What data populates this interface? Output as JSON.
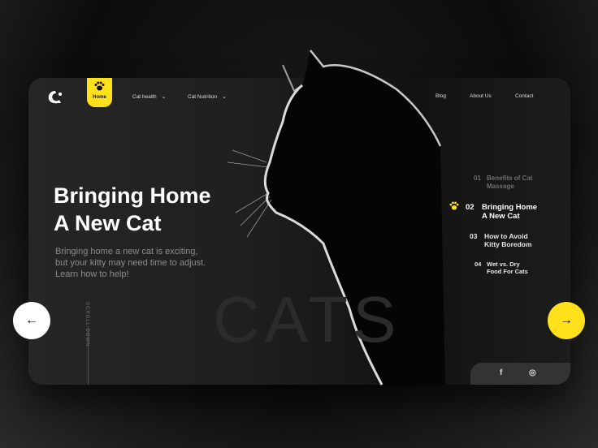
{
  "nav": {
    "home": "Home",
    "cat_health": "Cat health",
    "cat_nutrition": "Cat Nutrition",
    "blog": "Blog",
    "about": "About Us",
    "contact": "Contact"
  },
  "hero": {
    "title_line1": "Bringing Home",
    "title_line2": "A New Cat",
    "subtitle_line1": "Bringing home a new cat is exciting,",
    "subtitle_line2": "but your kitty may need time to adjust.",
    "subtitle_line3": "Learn how to help!",
    "background_word": "CATS",
    "scroll_label": "SCROLL DOWN"
  },
  "articles": [
    {
      "num": "01",
      "line1": "Benefits of Cat",
      "line2": "Massage"
    },
    {
      "num": "02",
      "line1": "Bringing Home",
      "line2": "A New Cat"
    },
    {
      "num": "03",
      "line1": "How to Avoid",
      "line2": "Kitty Boredom"
    },
    {
      "num": "04",
      "line1": "Wet vs. Dry",
      "line2": "Food For Cats"
    }
  ],
  "social": {
    "facebook": "f",
    "instagram": "◎"
  },
  "colors": {
    "accent": "#ffe01b",
    "card": "#222222",
    "text": "#ffffff",
    "muted": "#8c8c8c"
  },
  "icons": {
    "prev": "arrow-left-icon",
    "next": "arrow-right-icon",
    "paw": "paw-icon"
  }
}
